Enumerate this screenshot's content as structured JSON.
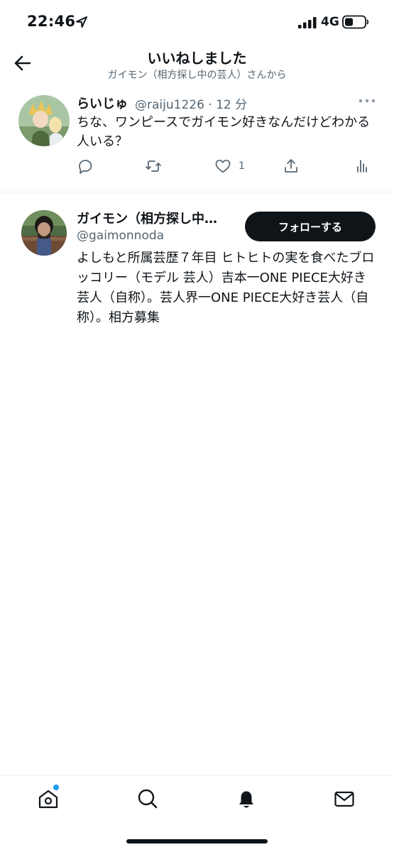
{
  "status_bar": {
    "time": "22:46",
    "network": "4G",
    "icons": [
      "location-arrow-icon",
      "signal-icon",
      "battery-icon"
    ]
  },
  "header": {
    "title": "いいねしました",
    "subtitle": "ガイモン（相方探し中の芸人）さんから",
    "back_icon": "back-arrow-icon"
  },
  "tweet": {
    "display_name": "らいじゅ",
    "handle_time": "@raiju1226 · 12 分",
    "text": "ちな、ワンピースでガイモン好きなんだけどわかる人いる？",
    "actions": {
      "reply_icon": "reply-icon",
      "retweet_icon": "retweet-icon",
      "like_icon": "heart-icon",
      "like_count": "1",
      "share_icon": "share-icon",
      "analytics_icon": "analytics-icon"
    }
  },
  "user_card": {
    "display_name": "ガイモン（相方探し中…",
    "handle": "@gaimonnoda",
    "follow_label": "フォローする",
    "bio": "よしもと所属芸歴７年目 ヒトヒトの実を食べたブロッコリー（モデル 芸人）吉本一ONE PIECE大好き芸人（自称）。芸人界一ONE PIECE大好き芸人（自称）。相方募集"
  },
  "tab_bar": {
    "items": [
      "home-icon",
      "search-icon",
      "notifications-icon",
      "messages-icon"
    ],
    "active": "notifications-icon"
  },
  "colors": {
    "text": "#0f1419",
    "secondary_text": "#536471",
    "follow_button": "#0f1419",
    "accent": "#1d9bf0",
    "divider": "#eff3f4"
  }
}
